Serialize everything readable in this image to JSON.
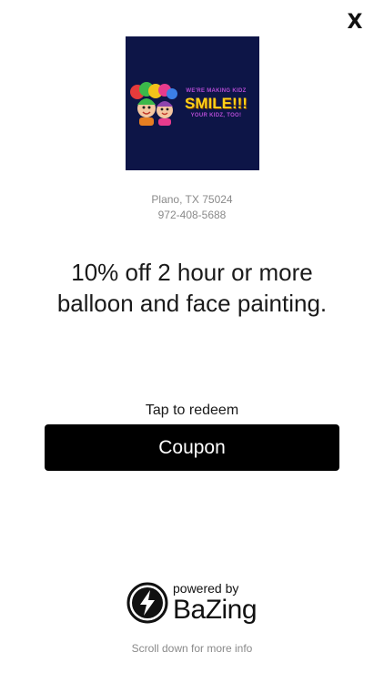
{
  "close": {
    "label": "X"
  },
  "business": {
    "logo": {
      "tagline_top": "WE'RE MAKING KIDZ",
      "headline": "SMILE!!!",
      "tagline_bottom": "YOUR KIDZ, TOO!",
      "background_color": "#0d1547"
    },
    "location": "Plano, TX 75024",
    "phone": "972-408-5688"
  },
  "offer": {
    "text": "10% off 2 hour or more balloon and face painting."
  },
  "redeem": {
    "prompt": "Tap to redeem",
    "button_label": "Coupon"
  },
  "footer": {
    "powered_by": "powered by",
    "brand": "BaZing",
    "brand_icon": "lightning-bolt-icon",
    "scroll_hint": "Scroll down for more info"
  }
}
